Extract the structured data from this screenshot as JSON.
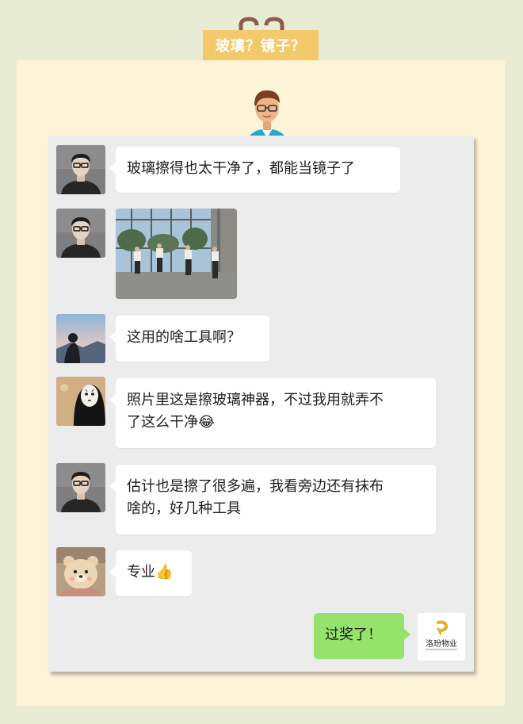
{
  "header": {
    "title": "玻璃？镜子？"
  },
  "messages": [
    {
      "sender": "man-glasses",
      "text": "玻璃擦得也太干净了，都能当镜子了"
    },
    {
      "sender": "man-glasses",
      "image": "photo-people-standing-by-glass-wall"
    },
    {
      "sender": "girl-sunset",
      "text": "这用的啥工具啊？"
    },
    {
      "sender": "no-face",
      "text_line1": "照片里这是擦玻璃神器，不过我用就弄不",
      "text_line2": "了这么干净😂"
    },
    {
      "sender": "man-glasses",
      "text_line1": "估计也是擦了很多遍，我看旁边还有抹布",
      "text_line2": "啥的，好几种工具"
    },
    {
      "sender": "bear",
      "text": "专业👍"
    },
    {
      "sender": "self-logo",
      "text": "过奖了！",
      "logo_text": "洛玢物业"
    }
  ],
  "colors": {
    "page_bg": "#e9ecd5",
    "panel_bg": "#fdf3d6",
    "title_tag": "#f3c96b",
    "chat_bg": "#ececec",
    "incoming_bubble": "#ffffff",
    "outgoing_bubble": "#95e36a"
  }
}
